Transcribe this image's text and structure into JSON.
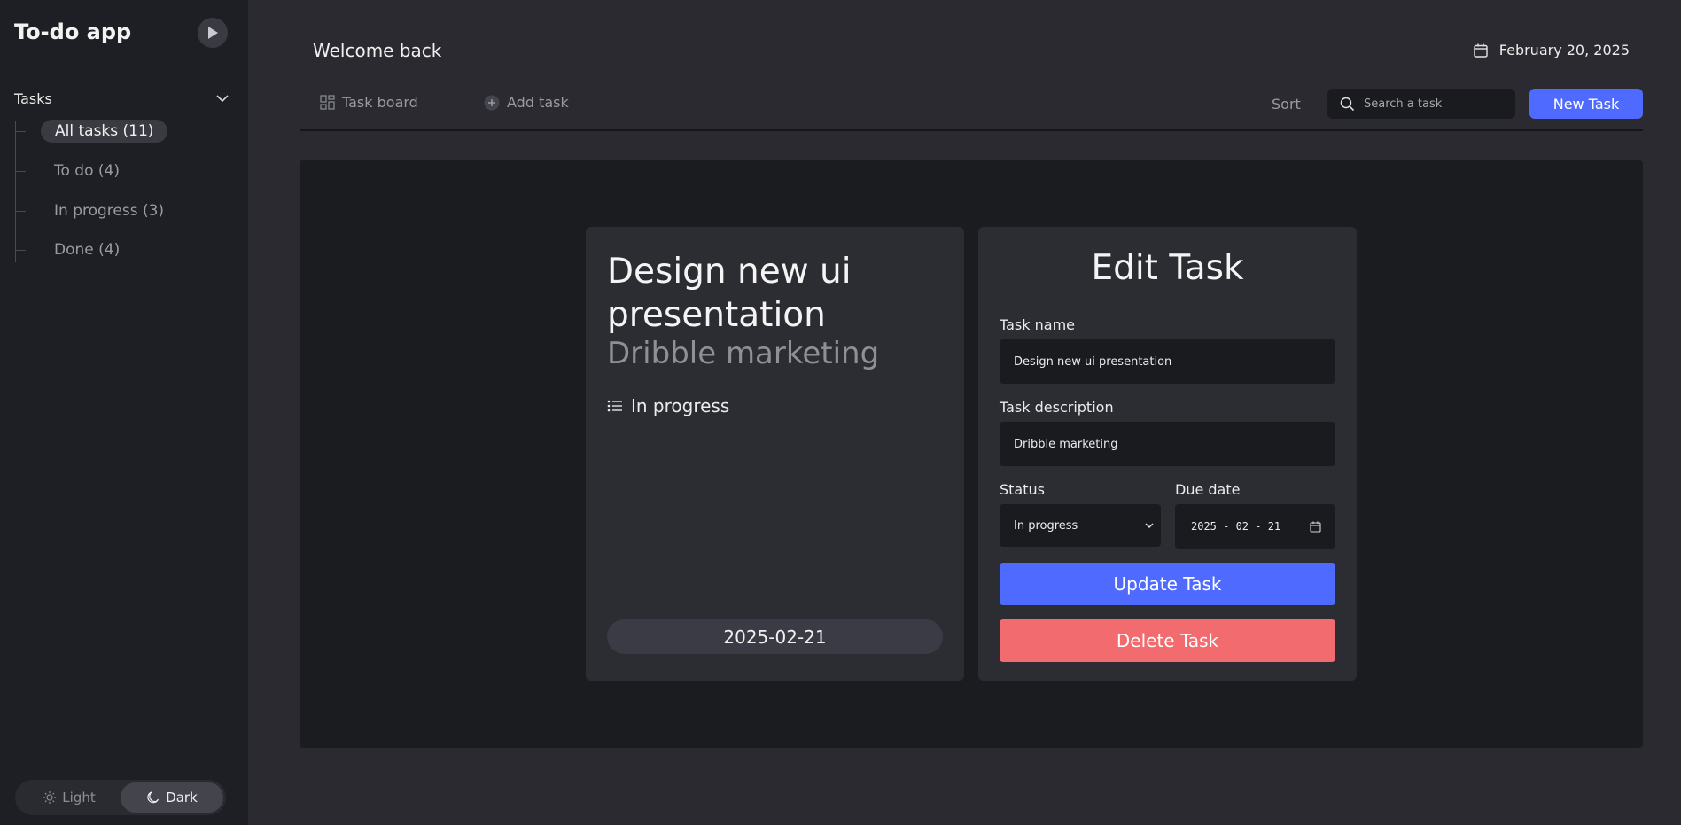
{
  "app": {
    "title": "To-do app"
  },
  "sidebar": {
    "section_label": "Tasks",
    "items": [
      {
        "label": "All tasks (11)",
        "active": true
      },
      {
        "label": "To do (4)",
        "active": false
      },
      {
        "label": "In progress (3)",
        "active": false
      },
      {
        "label": "Done (4)",
        "active": false
      }
    ],
    "theme": {
      "light_label": "Light",
      "dark_label": "Dark",
      "selected": "Dark"
    }
  },
  "header": {
    "welcome": "Welcome back",
    "date": "February 20, 2025"
  },
  "toolbar": {
    "task_board_label": "Task board",
    "add_task_label": "Add task",
    "sort_label": "Sort",
    "search_placeholder": "Search a task",
    "new_task_label": "New Task"
  },
  "task_card": {
    "title": "Design new ui presentation",
    "description": "Dribble marketing",
    "status": "In progress",
    "due_date": "2025-02-21"
  },
  "edit_form": {
    "title": "Edit Task",
    "name_label": "Task name",
    "name_value": "Design new ui presentation",
    "description_label": "Task description",
    "description_value": "Dribble marketing",
    "status_label": "Status",
    "status_value": "In progress",
    "due_label": "Due date",
    "due_value": "2025 - 02 - 21",
    "update_label": "Update Task",
    "delete_label": "Delete Task"
  },
  "colors": {
    "accent": "#4f6bff",
    "danger": "#f26b6e",
    "sidebar_bg": "#1e1f24",
    "main_bg": "#2a2a30",
    "board_bg": "#1b1c20",
    "card_bg": "#2c2c33"
  }
}
